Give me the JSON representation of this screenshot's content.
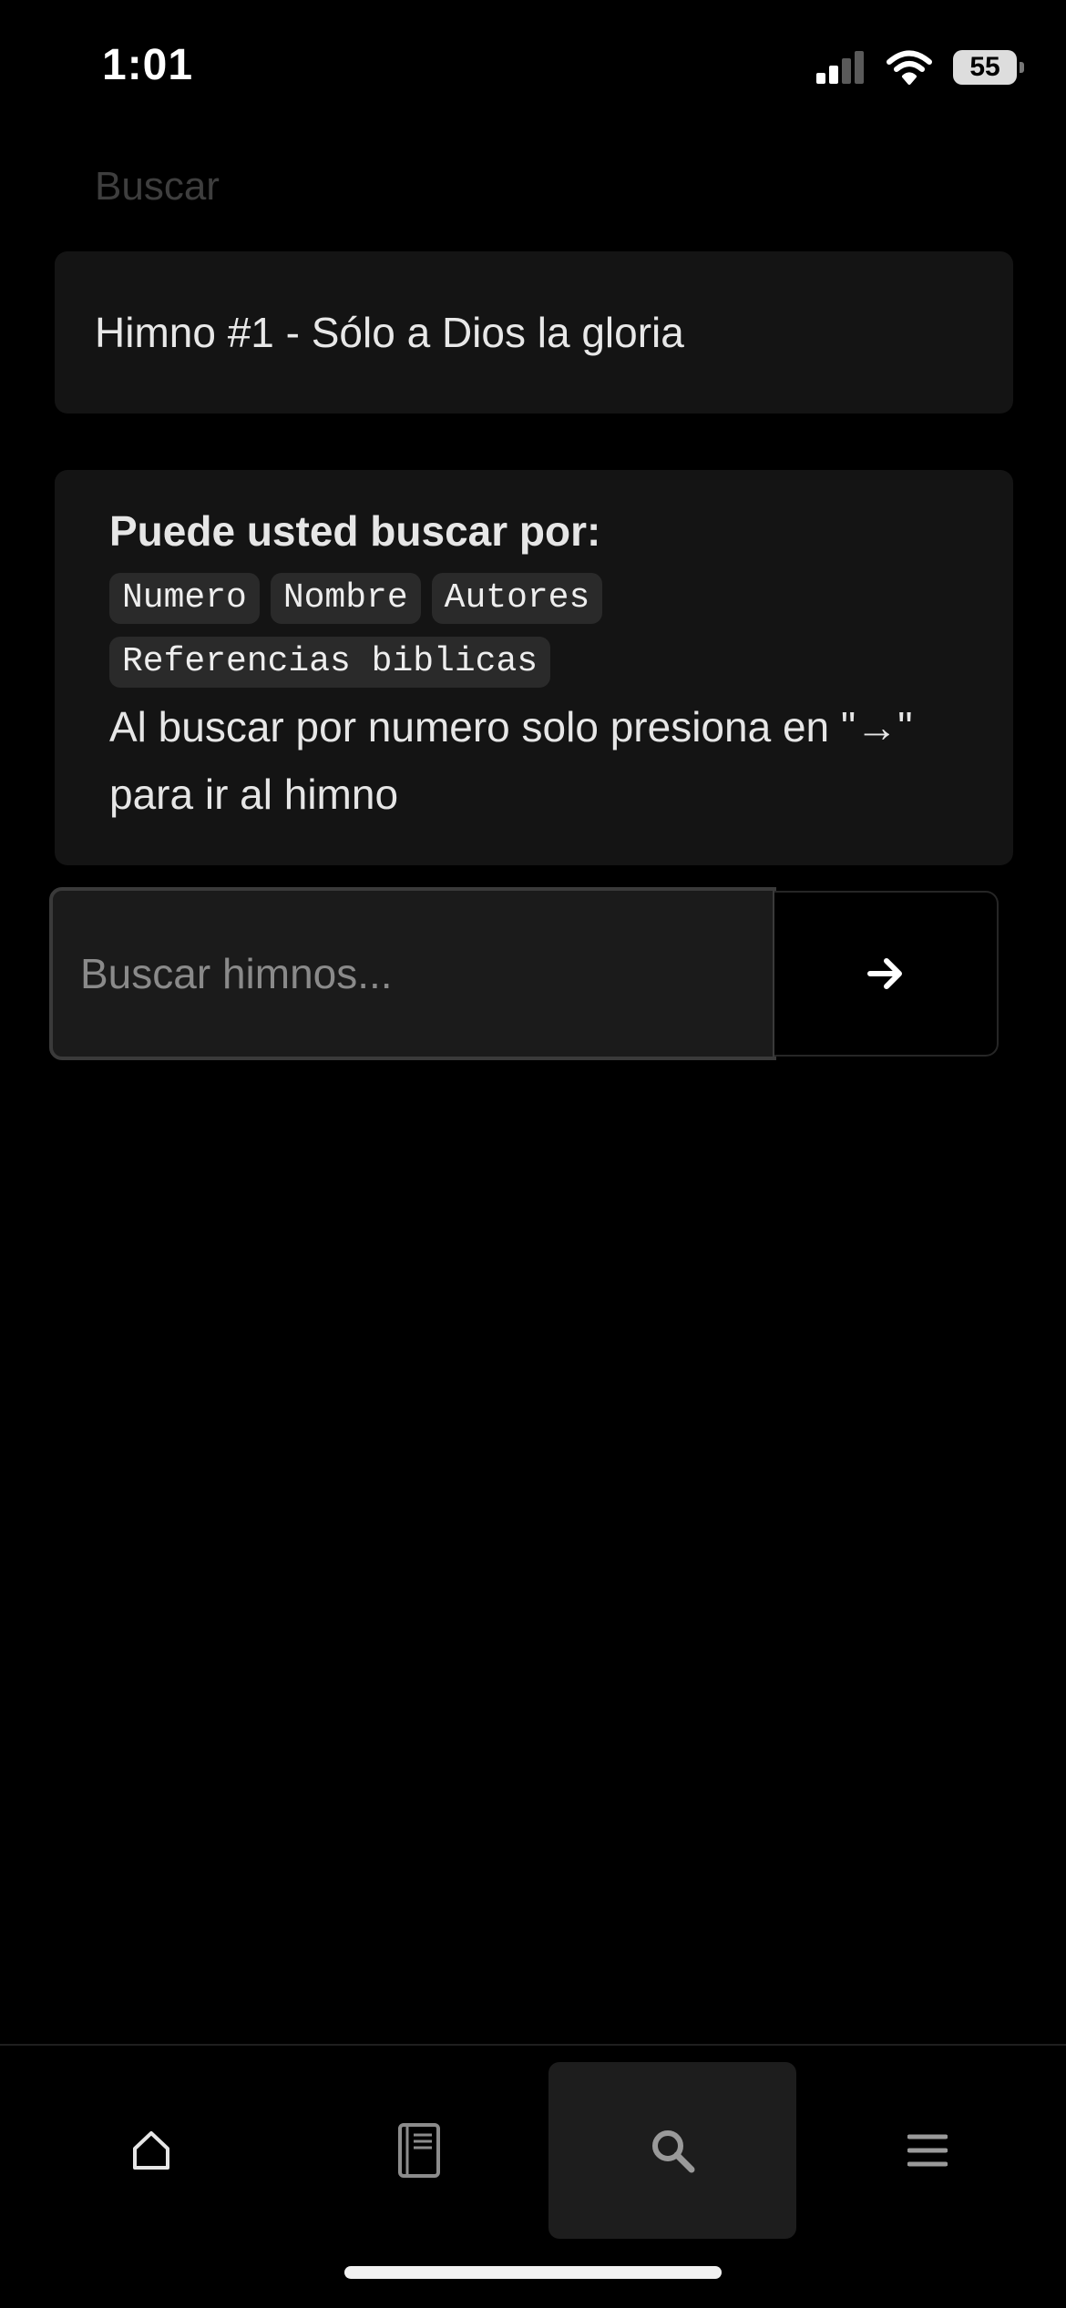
{
  "status_bar": {
    "time": "1:01",
    "battery": "55",
    "icons": [
      "cellular-signal-icon",
      "wifi-icon",
      "battery-icon"
    ]
  },
  "header": {
    "title": "Buscar"
  },
  "result": {
    "label": "Himno #1 - Sólo a Dios la gloria"
  },
  "info": {
    "heading": "Puede usted buscar por:",
    "tags": [
      "Numero",
      "Nombre",
      "Autores",
      "Referencias biblicas"
    ],
    "note": "Al buscar por numero solo presiona en \"→\" para ir al himno"
  },
  "search": {
    "placeholder": "Buscar himnos...",
    "value": "",
    "submit_icon": "arrow-right-icon"
  },
  "tab_bar": {
    "tabs": [
      {
        "icon": "home-icon",
        "active": false
      },
      {
        "icon": "hymnal-book-icon",
        "active": false
      },
      {
        "icon": "search-icon",
        "active": true
      },
      {
        "icon": "menu-icon",
        "active": false
      }
    ]
  },
  "colors": {
    "background": "#000000",
    "card": "#141414",
    "tag_background": "#2a2a2a",
    "active_tab": "#1d1d1d",
    "text": "#e6e6e6",
    "muted_title": "#3e3e3e"
  }
}
